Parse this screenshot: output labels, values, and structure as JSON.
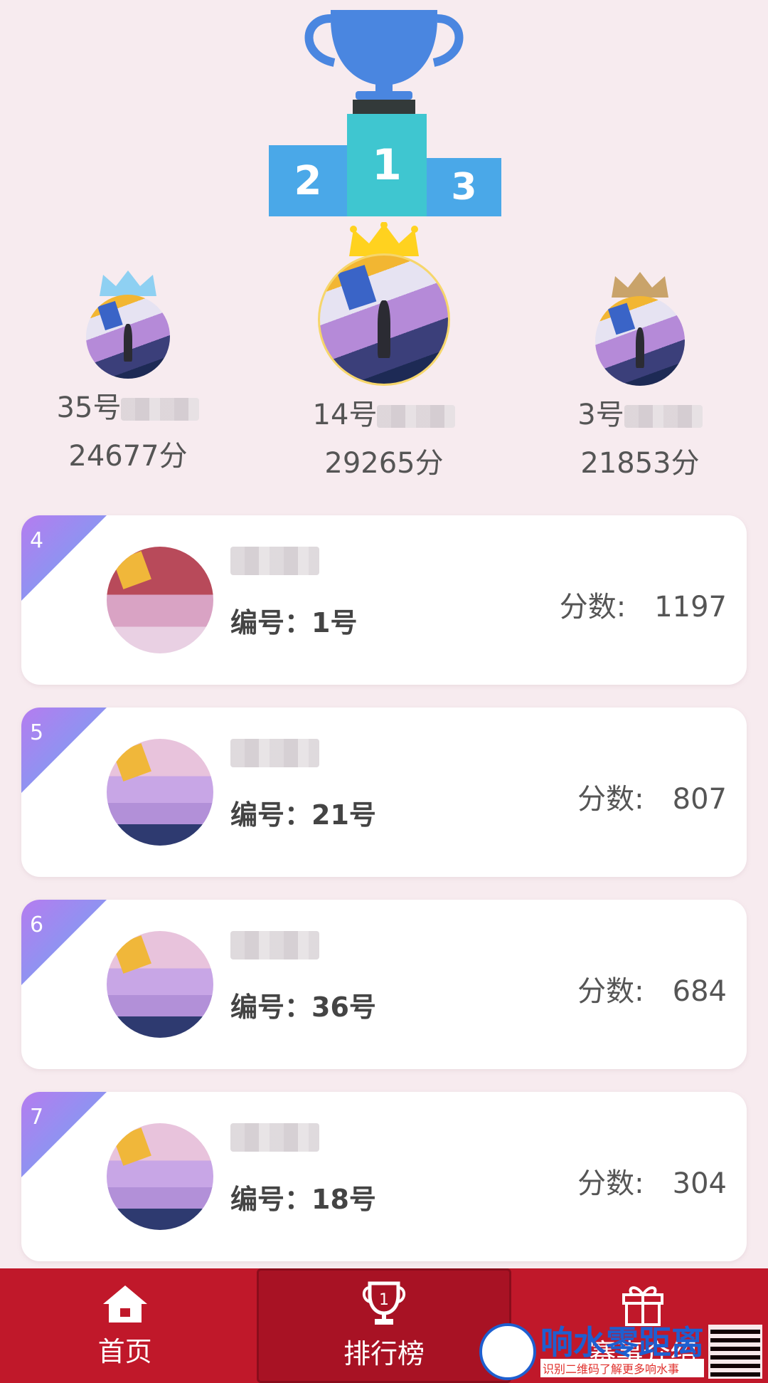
{
  "podium": {
    "first": "1",
    "second": "2",
    "third": "3"
  },
  "top_three": [
    {
      "rank": 2,
      "name": "35号",
      "score": "24677分",
      "crown_color": "#8ed0f2"
    },
    {
      "rank": 1,
      "name": "14号",
      "score": "29265分",
      "crown_color": "#ffd21f"
    },
    {
      "rank": 3,
      "name": "3号",
      "score": "21853分",
      "crown_color": "#c9a36a"
    }
  ],
  "list": [
    {
      "rank": "4",
      "id_label": "编号：1号",
      "score_label": "分数:",
      "score": "1197"
    },
    {
      "rank": "5",
      "id_label": "编号：21号",
      "score_label": "分数:",
      "score": "807"
    },
    {
      "rank": "6",
      "id_label": "编号：36号",
      "score_label": "分数:",
      "score": "684"
    },
    {
      "rank": "7",
      "id_label": "编号：18号",
      "score_label": "分数:",
      "score": "304"
    }
  ],
  "nav": {
    "home": "首页",
    "ranking": "排行榜",
    "third": "赛事介绍"
  },
  "watermark": {
    "title": "响水零距离",
    "subtitle": "识别二维码了解更多响水事"
  },
  "colors": {
    "nav_bg": "#c0182a",
    "accent_blue": "#4aa8e8",
    "accent_cyan": "#3fc6d0"
  }
}
